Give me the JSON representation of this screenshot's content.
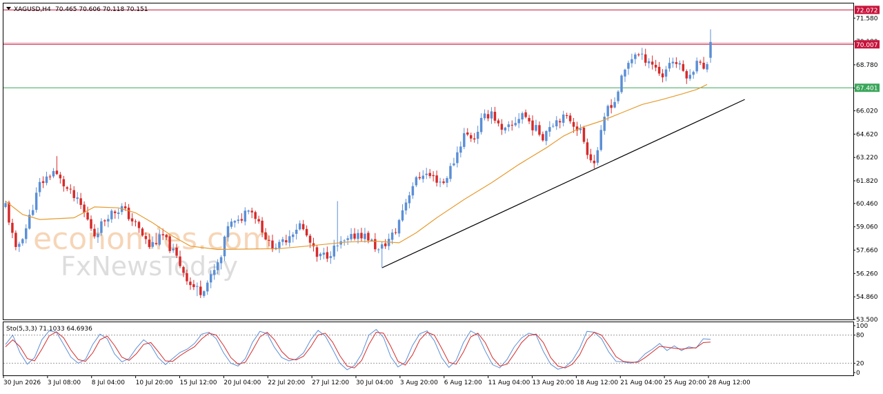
{
  "header": {
    "symbol": "XAGUSD,H4",
    "ohlc": "70.465 70.606 70.118 70.151"
  },
  "watermark": {
    "line1": "economies.com",
    "line2": "FxNewsToday"
  },
  "stochastic": {
    "label": "Sto(5,3,3) 71.1033 64.6936"
  },
  "chart_data": [
    {
      "type": "candlestick",
      "title": "XAGUSD,H4",
      "ylim": [
        53.5,
        72.46
      ],
      "y_ticks": [
        71.58,
        70.18,
        68.78,
        67.38,
        66.02,
        64.62,
        63.22,
        61.82,
        60.46,
        59.06,
        57.66,
        56.26,
        54.86,
        53.5
      ],
      "y_tick_labels": [
        "71.580",
        "70.180",
        "68.780",
        "67.380",
        "66.020",
        "64.620",
        "63.220",
        "61.820",
        "60.460",
        "59.060",
        "57.660",
        "56.260",
        "54.860",
        "53.500"
      ],
      "x_tick_labels": [
        "30 Jun 2026",
        "3 Jul 08:00",
        "8 Jul 04:00",
        "10 Jul 20:00",
        "15 Jul 12:00",
        "20 Jul 04:00",
        "22 Jul 20:00",
        "27 Jul 12:00",
        "30 Jul 04:00",
        "3 Aug 20:00",
        "6 Aug 12:00",
        "11 Aug 04:00",
        "13 Aug 20:00",
        "18 Aug 12:00",
        "21 Aug 04:00",
        "25 Aug 20:00",
        "28 Aug 12:00"
      ],
      "horizontal_levels": [
        {
          "value": 72.072,
          "label": "72.072",
          "color": "#c8143c"
        },
        {
          "value": 70.007,
          "label": "70.007",
          "color": "#c8143c"
        },
        {
          "value": 67.401,
          "label": "67.401",
          "color": "#3aa65a"
        }
      ],
      "close_path": [
        [
          0,
          60.4
        ],
        [
          3,
          57.6
        ],
        [
          6,
          59.0
        ],
        [
          10,
          61.6
        ],
        [
          14,
          62.4
        ],
        [
          18,
          61.3
        ],
        [
          22,
          60.3
        ],
        [
          26,
          58.6
        ],
        [
          30,
          59.8
        ],
        [
          34,
          60.2
        ],
        [
          38,
          59.2
        ],
        [
          42,
          57.9
        ],
        [
          46,
          58.5
        ],
        [
          50,
          57.2
        ],
        [
          54,
          55.6
        ],
        [
          57,
          55.2
        ],
        [
          60,
          56.0
        ],
        [
          63,
          57.2
        ],
        [
          65,
          59.2
        ],
        [
          68,
          59.3
        ],
        [
          71,
          60.3
        ],
        [
          74,
          59.4
        ],
        [
          77,
          58.0
        ],
        [
          80,
          57.9
        ],
        [
          83,
          58.6
        ],
        [
          86,
          59.2
        ],
        [
          88,
          58.5
        ],
        [
          91,
          57.2
        ],
        [
          94,
          57.4
        ],
        [
          97,
          57.9
        ],
        [
          100,
          58.2
        ],
        [
          103,
          58.7
        ],
        [
          106,
          58.4
        ],
        [
          109,
          57.6
        ],
        [
          112,
          58.3
        ],
        [
          114,
          58.8
        ],
        [
          116,
          60.1
        ],
        [
          119,
          61.6
        ],
        [
          122,
          62.3
        ],
        [
          125,
          62.0
        ],
        [
          128,
          61.7
        ],
        [
          131,
          63.0
        ],
        [
          134,
          64.6
        ],
        [
          137,
          64.4
        ],
        [
          139,
          65.4
        ],
        [
          142,
          66.0
        ],
        [
          145,
          64.7
        ],
        [
          148,
          65.1
        ],
        [
          151,
          65.9
        ],
        [
          154,
          65.1
        ],
        [
          157,
          64.5
        ],
        [
          159,
          65.2
        ],
        [
          162,
          65.6
        ],
        [
          165,
          65.5
        ],
        [
          168,
          64.8
        ],
        [
          170,
          63.6
        ],
        [
          172,
          62.9
        ],
        [
          174,
          64.6
        ],
        [
          176,
          66.3
        ],
        [
          178,
          66.6
        ],
        [
          180,
          67.9
        ],
        [
          182,
          68.9
        ],
        [
          184,
          69.5
        ],
        [
          186,
          69.2
        ],
        [
          188,
          69.1
        ],
        [
          190,
          68.6
        ],
        [
          192,
          68.1
        ],
        [
          194,
          69.0
        ],
        [
          196,
          68.9
        ],
        [
          198,
          68.4
        ],
        [
          200,
          68.0
        ],
        [
          202,
          69.2
        ],
        [
          204,
          68.4
        ],
        [
          205,
          68.9
        ],
        [
          206,
          70.15
        ]
      ],
      "moving_average": [
        [
          0,
          60.6
        ],
        [
          5,
          59.8
        ],
        [
          10,
          59.5
        ],
        [
          20,
          59.6
        ],
        [
          26,
          60.25
        ],
        [
          33,
          60.2
        ],
        [
          38,
          59.9
        ],
        [
          43,
          59.3
        ],
        [
          48,
          58.6
        ],
        [
          54,
          57.9
        ],
        [
          62,
          57.7
        ],
        [
          80,
          57.75
        ],
        [
          88,
          57.9
        ],
        [
          100,
          58.15
        ],
        [
          108,
          58.2
        ],
        [
          115,
          58.1
        ],
        [
          120,
          58.7
        ],
        [
          126,
          59.6
        ],
        [
          134,
          60.7
        ],
        [
          142,
          61.7
        ],
        [
          150,
          62.8
        ],
        [
          158,
          63.8
        ],
        [
          163,
          64.5
        ],
        [
          168,
          65.0
        ],
        [
          174,
          65.4
        ],
        [
          180,
          65.9
        ],
        [
          186,
          66.4
        ],
        [
          192,
          66.7
        ],
        [
          198,
          67.05
        ],
        [
          202,
          67.3
        ],
        [
          205,
          67.6
        ]
      ],
      "trendline": [
        [
          110,
          56.6
        ],
        [
          216,
          66.7
        ]
      ],
      "highs": [
        [
          15,
          63.3
        ],
        [
          44,
          58.7
        ],
        [
          97,
          60.6
        ],
        [
          206,
          70.9
        ]
      ],
      "lows": [
        [
          56,
          54.9
        ],
        [
          110,
          56.6
        ],
        [
          171,
          62.9
        ]
      ]
    },
    {
      "type": "line",
      "title": "Sto(5,3,3) 71.1033 64.6936",
      "ylim": [
        0,
        100
      ],
      "y_ticks": [
        100,
        80,
        20,
        0
      ],
      "y_tick_labels": [
        "100",
        "80",
        "20",
        "0"
      ],
      "levels": [
        80,
        20
      ],
      "series": [
        {
          "color": "#5b8fd6",
          "values": [
            60,
            80,
            42,
            18,
            32,
            70,
            89,
            86,
            60,
            33,
            20,
            28,
            60,
            82,
            72,
            40,
            23,
            30,
            52,
            70,
            58,
            32,
            17,
            30,
            43,
            50,
            62,
            82,
            86,
            72,
            42,
            20,
            14,
            30,
            65,
            88,
            83,
            54,
            32,
            25,
            29,
            42,
            70,
            90,
            78,
            50,
            20,
            6,
            15,
            40,
            80,
            92,
            75,
            34,
            12,
            22,
            58,
            83,
            89,
            68,
            32,
            11,
            26,
            64,
            89,
            80,
            46,
            17,
            10,
            28,
            55,
            74,
            84,
            80,
            45,
            18,
            7,
            12,
            26,
            52,
            88,
            86,
            72,
            44,
            24,
            23,
            20,
            24,
            40,
            50,
            62,
            47,
            57,
            47,
            55,
            52,
            72,
            71
          ]
        },
        {
          "color": "#d62a2a",
          "values": [
            55,
            70,
            55,
            30,
            25,
            50,
            78,
            87,
            74,
            48,
            28,
            24,
            42,
            70,
            78,
            58,
            33,
            26,
            40,
            60,
            64,
            45,
            25,
            24,
            36,
            46,
            55,
            72,
            84,
            80,
            58,
            32,
            18,
            22,
            48,
            76,
            86,
            70,
            45,
            30,
            27,
            35,
            55,
            80,
            84,
            65,
            36,
            14,
            10,
            26,
            60,
            86,
            84,
            56,
            24,
            16,
            38,
            70,
            86,
            80,
            52,
            22,
            18,
            44,
            76,
            84,
            64,
            32,
            14,
            18,
            40,
            64,
            79,
            82,
            64,
            32,
            14,
            10,
            18,
            38,
            70,
            86,
            80,
            58,
            34,
            24,
            22,
            22,
            32,
            44,
            56,
            54,
            52,
            50,
            52,
            53,
            64,
            65
          ]
        }
      ]
    }
  ]
}
